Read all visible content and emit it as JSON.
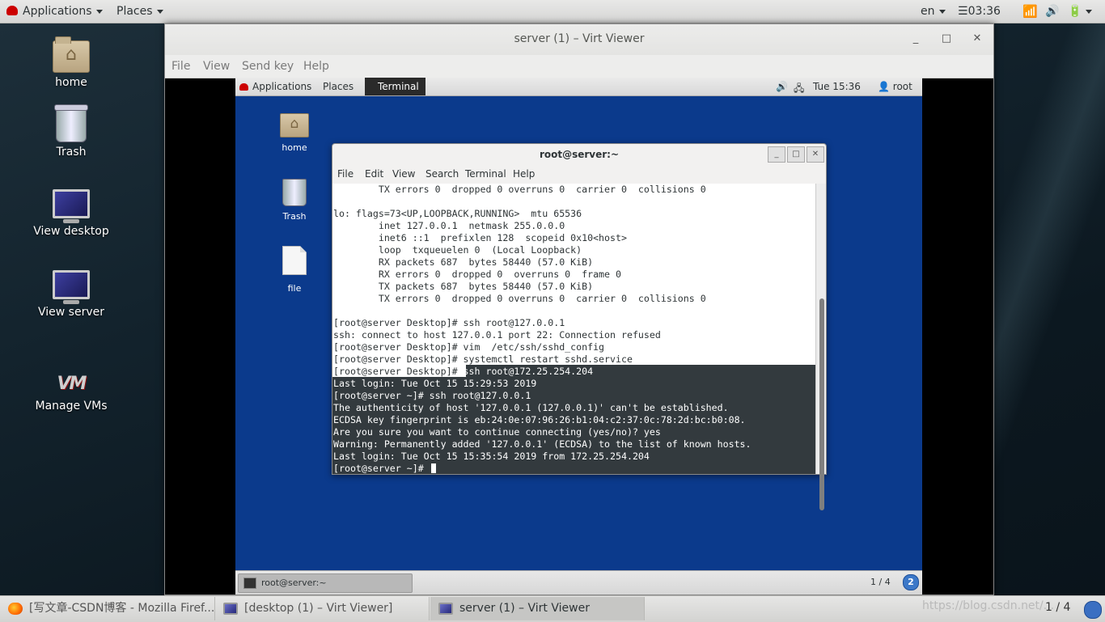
{
  "host_topbar": {
    "applications": "Applications",
    "places": "Places",
    "lang": "en",
    "time": "03:36"
  },
  "host_desktop_icons": [
    {
      "label": "home"
    },
    {
      "label": "Trash"
    },
    {
      "label": "View desktop"
    },
    {
      "label": "View server"
    },
    {
      "label": "Manage VMs"
    }
  ],
  "vv_window": {
    "title": "server (1) – Virt Viewer",
    "menu": [
      "File",
      "View",
      "Send key",
      "Help"
    ]
  },
  "guest": {
    "topbar": {
      "applications": "Applications",
      "places": "Places",
      "terminal": "Terminal",
      "datetime": "Tue 15:36",
      "user": "root"
    },
    "icons": [
      {
        "label": "home"
      },
      {
        "label": "Trash"
      },
      {
        "label": "file"
      }
    ],
    "terminal": {
      "title": "root@server:~",
      "menu": [
        "File",
        "Edit",
        "View",
        "Search",
        "Terminal",
        "Help"
      ],
      "lines": [
        "        TX errors 0  dropped 0 overruns 0  carrier 0  collisions 0",
        "",
        "lo: flags=73<UP,LOOPBACK,RUNNING>  mtu 65536",
        "        inet 127.0.0.1  netmask 255.0.0.0",
        "        inet6 ::1  prefixlen 128  scopeid 0x10<host>",
        "        loop  txqueuelen 0  (Local Loopback)",
        "        RX packets 687  bytes 58440 (57.0 KiB)",
        "        RX errors 0  dropped 0  overruns 0  frame 0",
        "        TX packets 687  bytes 58440 (57.0 KiB)",
        "        TX errors 0  dropped 0 overruns 0  carrier 0  collisions 0",
        "",
        "[root@server Desktop]# ssh root@127.0.0.1",
        "ssh: connect to host 127.0.0.1 port 22: Connection refused",
        "[root@server Desktop]# vim  /etc/ssh/sshd_config",
        "[root@server Desktop]# systemctl restart sshd.service"
      ],
      "sel_prompt": "[root@server Desktop]#",
      "sel_cmd": " ssh root@172.25.254.204",
      "dark_lines": [
        "Last login: Tue Oct 15 15:29:53 2019",
        "[root@server ~]# ssh root@127.0.0.1",
        "The authenticity of host '127.0.0.1 (127.0.0.1)' can't be established.",
        "ECDSA key fingerprint is eb:24:0e:07:96:26:b1:04:c2:37:0c:78:2d:bc:b0:08.",
        "Are you sure you want to continue connecting (yes/no)? yes",
        "Warning: Permanently added '127.0.0.1' (ECDSA) to the list of known hosts.",
        "Last login: Tue Oct 15 15:35:54 2019 from 172.25.254.204",
        "[root@server ~]# "
      ]
    },
    "bottom": {
      "task": "root@server:~",
      "pager": "1 / 4",
      "workspace": "2"
    }
  },
  "host_taskbar": {
    "tasks": [
      {
        "label": "[写文章-CSDN博客 - Mozilla Firef..."
      },
      {
        "label": "[desktop (1) – Virt Viewer]"
      },
      {
        "label": "server (1) – Virt Viewer"
      }
    ],
    "watermark": "https://blog.csdn.net/...",
    "pager": "1 / 4"
  }
}
